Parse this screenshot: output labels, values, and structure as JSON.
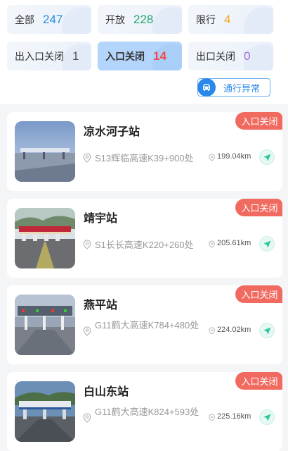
{
  "filters": [
    {
      "label": "全部",
      "count": "247",
      "color": "#2a8ee0",
      "active": false
    },
    {
      "label": "开放",
      "count": "228",
      "color": "#21a86b",
      "active": false
    },
    {
      "label": "限行",
      "count": "4",
      "color": "#f5a623",
      "active": false
    },
    {
      "label": "出入口关闭",
      "count": "1",
      "color": "#555555",
      "active": false
    },
    {
      "label": "入口关闭",
      "count": "14",
      "color": "#f04a48",
      "active": true
    },
    {
      "label": "出口关闭",
      "count": "0",
      "color": "#a070d8",
      "active": false
    }
  ],
  "abnormal_button": {
    "label": "通行异常",
    "icon": "car-icon"
  },
  "stations": [
    {
      "name": "凉水河子站",
      "location": "S13辉临高速K39+900处",
      "distance": "199.04km",
      "status": "入口关闭"
    },
    {
      "name": "靖宇站",
      "location": "S1长长高速K220+260处",
      "distance": "205.61km",
      "status": "入口关闭"
    },
    {
      "name": "燕平站",
      "location": "G11鹤大高速K784+480处",
      "distance": "224.02km",
      "status": "入口关闭"
    },
    {
      "name": "白山东站",
      "location": "G11鹤大高速K824+593处",
      "distance": "225.16km",
      "status": "入口关闭"
    }
  ],
  "colors": {
    "accent": "#2a88ea",
    "status_tag": "#f16a60",
    "active_chip": "#b3d5fb"
  }
}
